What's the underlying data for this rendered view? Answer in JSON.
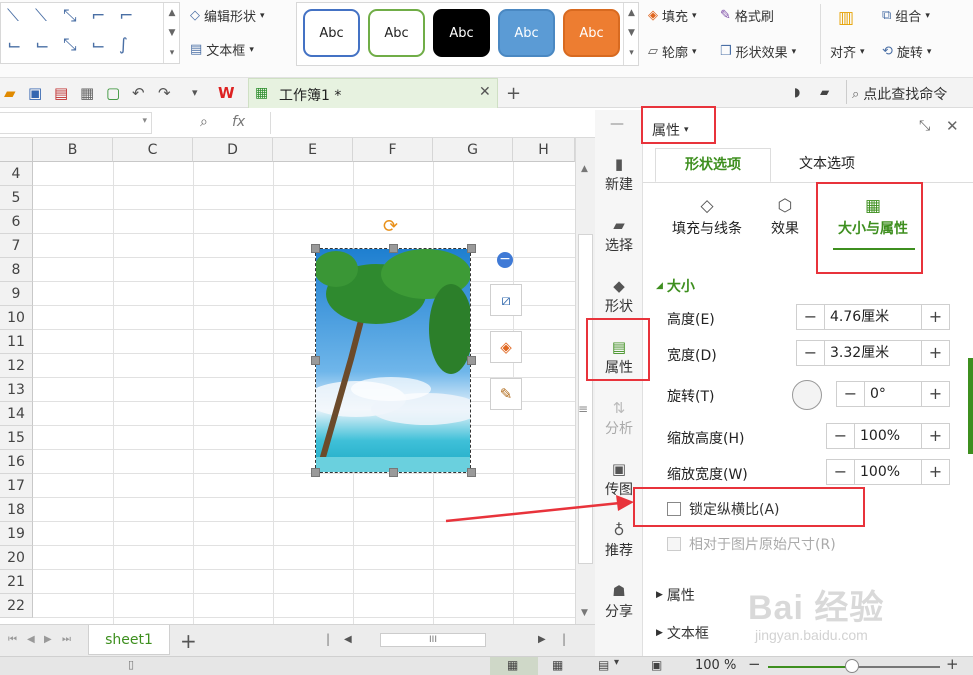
{
  "ribbon": {
    "edit_shape": "编辑形状",
    "text_box": "文本框",
    "style_samples": [
      {
        "label": "Abc",
        "bg": "#ffffff",
        "border": "#4472c4",
        "fg": "#222222"
      },
      {
        "label": "Abc",
        "bg": "#ffffff",
        "border": "#70ad47",
        "fg": "#222222"
      },
      {
        "label": "Abc",
        "bg": "#000000",
        "border": "#000000",
        "fg": "#ffffff"
      },
      {
        "label": "Abc",
        "bg": "#5b9bd5",
        "border": "#4a88c2",
        "fg": "#ffffff"
      },
      {
        "label": "Abc",
        "bg": "#ed7d31",
        "border": "#d86a20",
        "fg": "#ffffff"
      }
    ],
    "fill": "填充",
    "format_painter": "格式刷",
    "outline": "轮廓",
    "shape_effect": "形状效果",
    "align": "对齐",
    "group": "组合",
    "rotate": "旋转"
  },
  "tabbar": {
    "workbook_tab": "工作簿1 *",
    "search_command": "点此查找命令"
  },
  "formula": {
    "fx": "fx"
  },
  "columns": [
    "B",
    "C",
    "D",
    "E",
    "F",
    "G",
    "H"
  ],
  "rows": [
    "4",
    "5",
    "6",
    "7",
    "8",
    "9",
    "10",
    "11",
    "12",
    "13",
    "14",
    "15",
    "16",
    "17",
    "18",
    "19",
    "20",
    "21",
    "22"
  ],
  "sheet": {
    "tab": "sheet1",
    "add": "+"
  },
  "sidetools": [
    {
      "label": "新建",
      "icon": "new-icon"
    },
    {
      "label": "选择",
      "icon": "select-icon"
    },
    {
      "label": "形状",
      "icon": "shape-icon"
    },
    {
      "label": "属性",
      "icon": "properties-icon"
    },
    {
      "label": "分析",
      "icon": "analyze-icon"
    },
    {
      "label": "传图",
      "icon": "upload-image-icon"
    },
    {
      "label": "推荐",
      "icon": "recommend-icon"
    },
    {
      "label": "分享",
      "icon": "share-icon"
    }
  ],
  "panel": {
    "title": "属性",
    "tab_shape": "形状选项",
    "tab_text": "文本选项",
    "sub_fill_line": "填充与线条",
    "sub_effect": "效果",
    "sub_size": "大小与属性",
    "section_size": "大小",
    "height_label": "高度(E)",
    "height_value": "4.76厘米",
    "width_label": "宽度(D)",
    "width_value": "3.32厘米",
    "rotation_label": "旋转(T)",
    "rotation_value": "0°",
    "scale_height_label": "缩放高度(H)",
    "scale_height_value": "100%",
    "scale_width_label": "缩放宽度(W)",
    "scale_width_value": "100%",
    "lock_ratio_label": "锁定纵横比(A)",
    "relative_label": "相对于图片原始尺寸(R)",
    "section_props": "属性",
    "section_textbox": "文本框"
  },
  "status": {
    "zoom": "100 %"
  },
  "watermark": {
    "brand": "Bai 经验",
    "url": "jingyan.baidu.com"
  },
  "colors": {
    "accent_green": "#3e8f1f",
    "highlight_red": "#e8333b",
    "tab_green": "#e7f2e0"
  }
}
